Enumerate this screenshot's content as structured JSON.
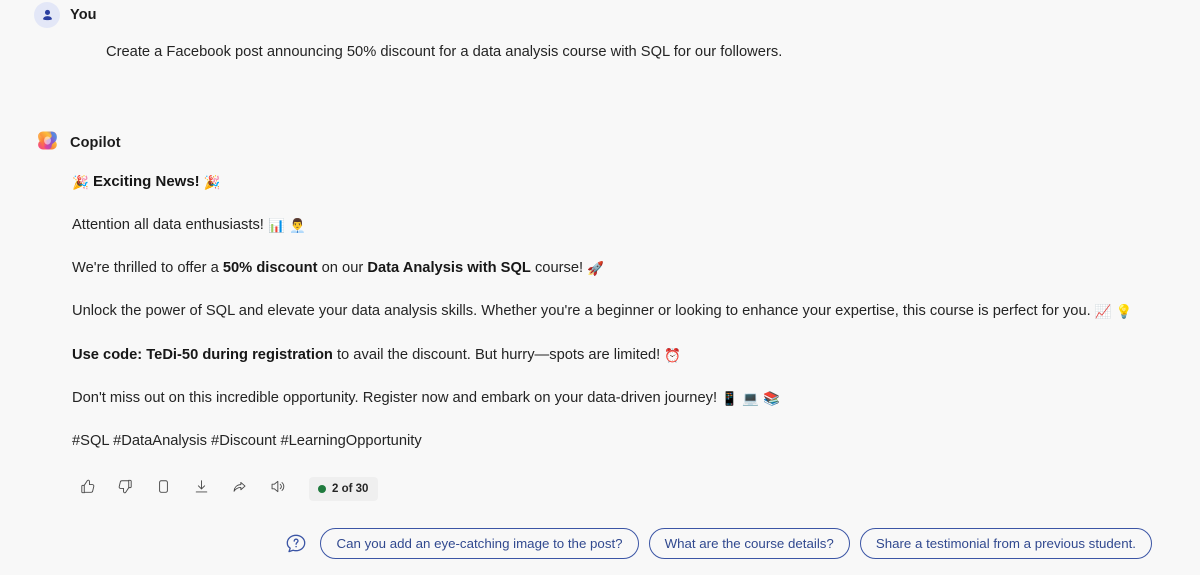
{
  "conversation": {
    "user": {
      "author": "You",
      "avatar_icon": "person-icon",
      "message": "Create a Facebook post announcing 50% discount for a data analysis course with SQL for our followers."
    },
    "assistant": {
      "author": "Copilot",
      "avatar_icon": "copilot-logo-icon",
      "paragraphs": {
        "heading_emoji_left": "🎉",
        "heading_text": "Exciting News!",
        "heading_emoji_right": "🎉",
        "p2_text": "Attention all data enthusiasts!",
        "p2_emoji": "📊 👨‍💼",
        "p3_a": "We're thrilled to offer a ",
        "p3_bold1": "50% discount",
        "p3_b": " on our ",
        "p3_bold2": "Data Analysis with SQL",
        "p3_c": " course! ",
        "p3_emoji": "🚀",
        "p4_text": "Unlock the power of SQL and elevate your data analysis skills. Whether you're a beginner or looking to enhance your expertise, this course is perfect for you. ",
        "p4_emoji": "📈 💡",
        "p5_bold": "Use code: TeDi-50 during registration",
        "p5_text": " to avail the discount. But hurry—spots are limited! ",
        "p5_emoji": "⏰",
        "p6_text": "Don't miss out on this incredible opportunity. Register now and embark on your data-driven journey! ",
        "p6_emoji": "📱 💻 📚",
        "p7_hashtags": "#SQL #DataAnalysis #Discount #LearningOpportunity"
      }
    }
  },
  "actions": {
    "like_label": "Like",
    "dislike_label": "Dislike",
    "copy_label": "Copy",
    "download_label": "Download",
    "share_label": "Share",
    "speak_label": "Read aloud",
    "counter": "2 of 30",
    "counter_status_color": "#1f7a3d"
  },
  "suggestions": {
    "prompt_icon": "question-bubble-icon",
    "chips": [
      {
        "label": "Can you add an eye-catching image to the post?"
      },
      {
        "label": "What are the course details?"
      },
      {
        "label": "Share a testimonial from a previous student."
      }
    ]
  },
  "theme": {
    "background": "#f8f8f8",
    "text": "#242424",
    "accent_blue": "#31498f",
    "user_avatar_bg": "#e3e7f7"
  }
}
